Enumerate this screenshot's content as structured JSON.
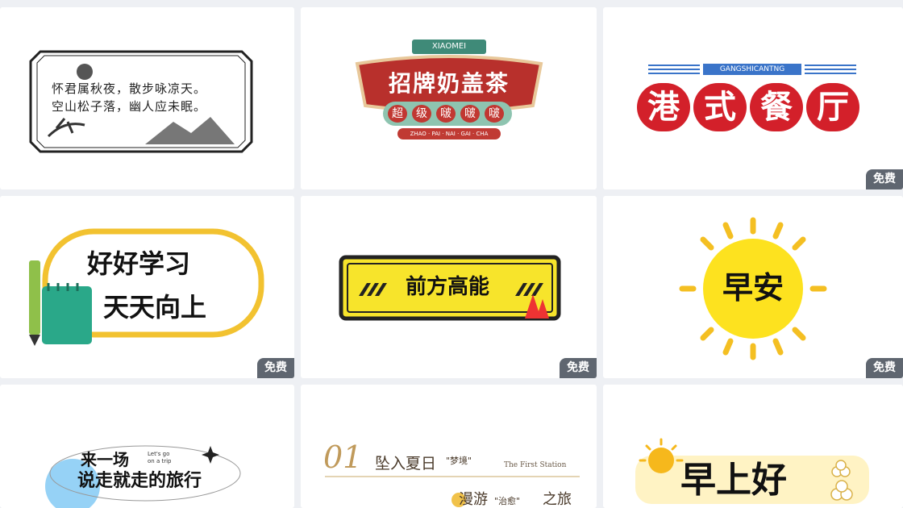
{
  "free_badge": "免费",
  "cards": [
    {
      "title_lines": [
        "怀君属秋夜，散步咏凉天。",
        "空山松子落，幽人应未眠。"
      ],
      "badge": ""
    },
    {
      "top_ribbon": "XIAOMEI",
      "title": "招牌奶盖茶",
      "subtitle_chars": [
        "超",
        "级",
        "啵",
        "啵",
        "啵"
      ],
      "pinyin": "ZHAO · PAI · NAI · GAI · CHA",
      "badge": ""
    },
    {
      "top_label": "GANGSHICANTNG",
      "title_chars": [
        "港",
        "式",
        "餐",
        "厅"
      ],
      "badge": "免费"
    },
    {
      "line1": "好好学习",
      "line2": "天天向上",
      "badge": "免费"
    },
    {
      "title": "前方高能",
      "badge": "免费"
    },
    {
      "title": "早安",
      "badge": "免费"
    },
    {
      "line1": "来一场",
      "small_en_1": "Let's go",
      "small_en_2": "on a trip",
      "line2": "说走就走的旅行",
      "badge": ""
    },
    {
      "number": "01",
      "title": "坠入夏日",
      "quote1": "\"梦境\"",
      "en": "The First Station",
      "line2a": "漫游",
      "quote2": "\"治愈\"",
      "line2b": "之旅",
      "badge": ""
    },
    {
      "title": "早上好",
      "badge": ""
    }
  ]
}
